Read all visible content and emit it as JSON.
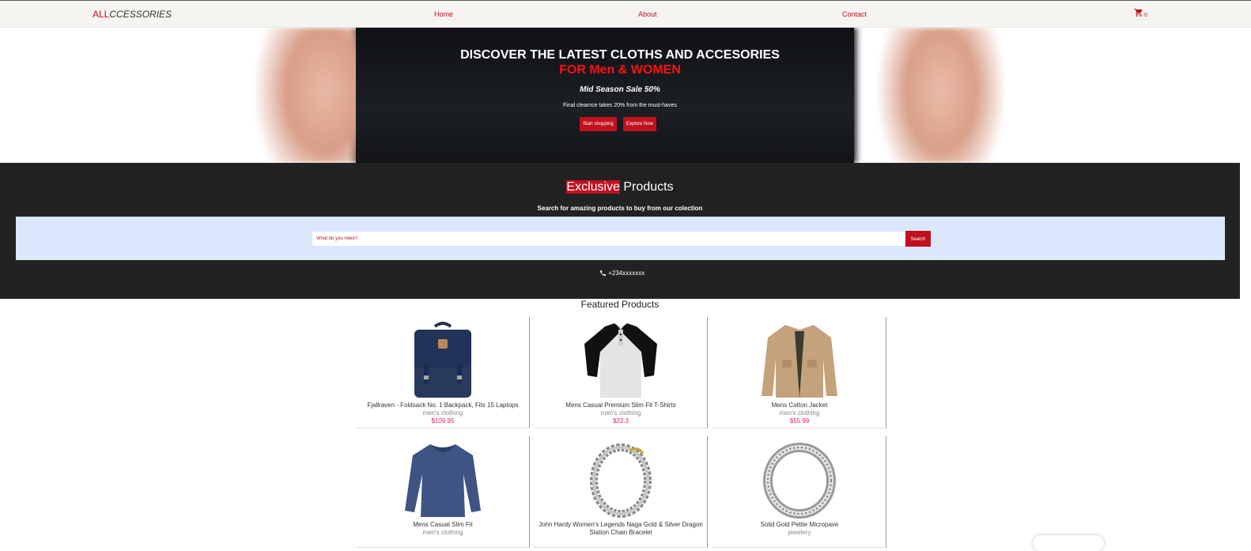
{
  "nav": {
    "logo_part1": "ALL",
    "logo_part2": "CCESSORIES",
    "links": [
      "Home",
      "About",
      "Contact"
    ],
    "cart_count": "0"
  },
  "hero": {
    "title": "DISCOVER THE LATEST CLOTHS AND ACCESORIES",
    "subtitle": "FOR Men & WOMEN",
    "sale": "Mid Season Sale 50%",
    "description": "Final clearnce takes 20% from the must-haves",
    "btn_start": "Start shopping",
    "btn_explore": "Explore Now"
  },
  "exclusive": {
    "title_highlight": "Exclusive",
    "title_rest": " Products",
    "subtitle": "Search for amazing products to buy from our colection",
    "search_placeholder": "What do you need?",
    "search_button": "Search",
    "phone": "+234xxxxxxx"
  },
  "featured": {
    "title": "Featured Products",
    "products": [
      {
        "name": "Fjallraven - Foldsack No. 1 Backpack, Fits 15 Laptops",
        "category": "men's clothing",
        "price": "$109.95",
        "icon": "backpack"
      },
      {
        "name": "Mens Casual Premium Slim Fit T-Shirts",
        "category": "men's clothing",
        "price": "$22.3",
        "icon": "raglan-tshirt"
      },
      {
        "name": "Mens Cotton Jacket",
        "category": "men's clothing",
        "price": "$55.99",
        "icon": "jacket"
      },
      {
        "name": "Mens Casual Slim Fit",
        "category": "men's clothing",
        "price": "",
        "icon": "long-sleeve-shirt"
      },
      {
        "name_line1": "John Hardy Women's Legends Naga Gold & Silver Dragon",
        "name_line2": "Station Chain Bracelet",
        "category": "",
        "price": "",
        "icon": "chain-bracelet"
      },
      {
        "name": "Solid Gold Petite Micropave",
        "category": "jewelery",
        "price": "",
        "icon": "ring"
      }
    ]
  },
  "colors": {
    "accent": "#c0111f",
    "price": "#e0245e",
    "dark": "#222222",
    "search_band": "#dbe8fb"
  }
}
